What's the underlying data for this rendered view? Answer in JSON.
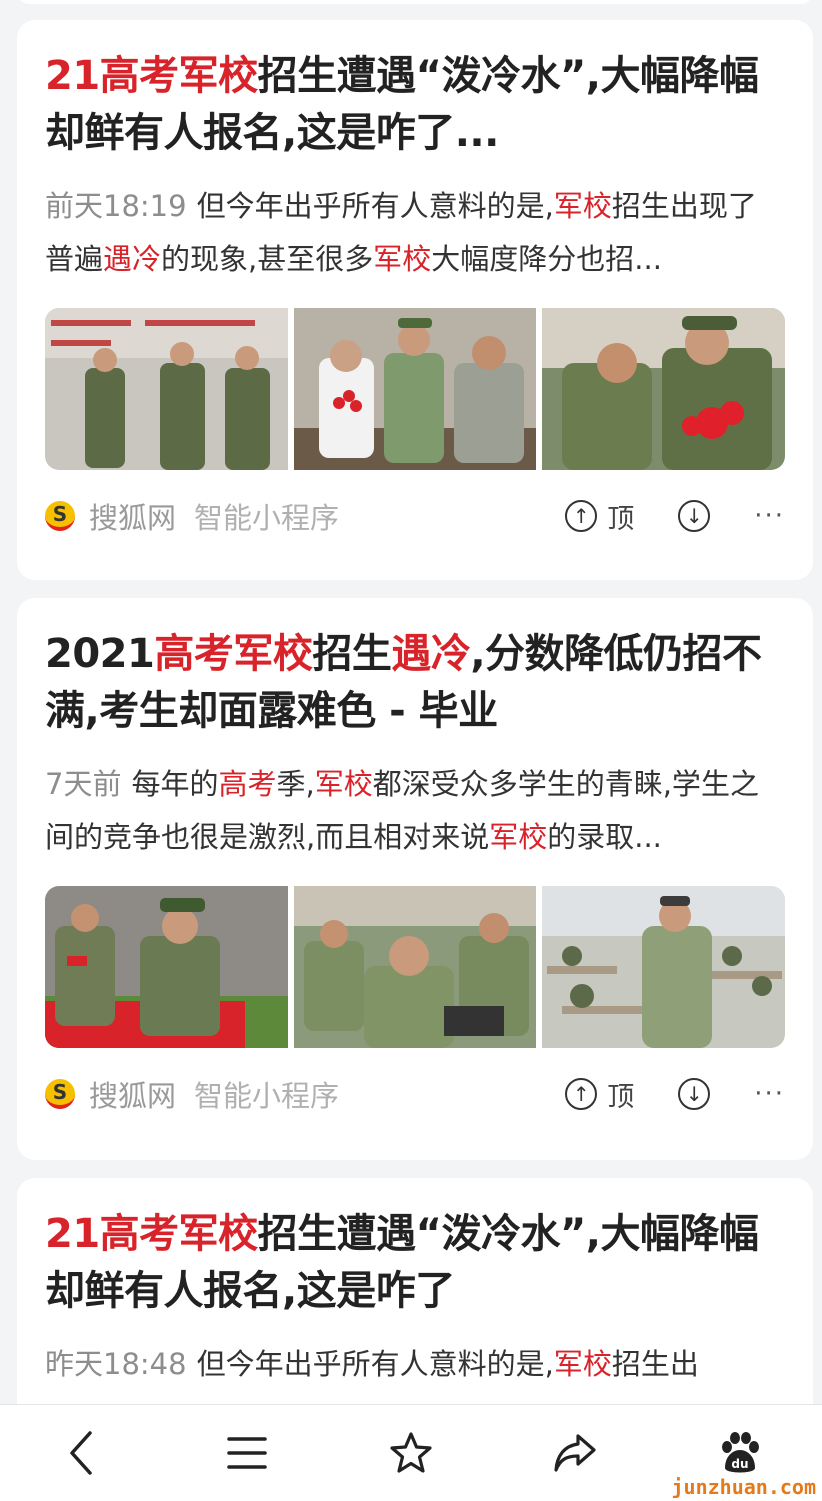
{
  "cards": [
    {
      "title_parts": [
        {
          "text": "21高考军校",
          "hl": true
        },
        {
          "text": "招生遭遇“泼冷水”,大幅降幅却鲜有人报名,这是咋了...",
          "hl": false
        }
      ],
      "time": "前天18:19",
      "snippet_parts": [
        {
          "text": "但今年出乎所有人意料的是,",
          "hl": false
        },
        {
          "text": "军校",
          "hl": true
        },
        {
          "text": "招生出现了普遍",
          "hl": false
        },
        {
          "text": "遇冷",
          "hl": true
        },
        {
          "text": "的现象,甚至很多",
          "hl": false
        },
        {
          "text": "军校",
          "hl": true
        },
        {
          "text": "大幅度降分也招...",
          "hl": false
        }
      ],
      "source": "搜狐网",
      "tag": "智能小程序",
      "up_label": "顶",
      "more": "···"
    },
    {
      "title_parts": [
        {
          "text": "2021",
          "hl": false
        },
        {
          "text": "高考军校",
          "hl": true
        },
        {
          "text": "招生",
          "hl": false
        },
        {
          "text": "遇冷",
          "hl": true
        },
        {
          "text": ",分数降低仍招不满,考生却面露难色 - 毕业",
          "hl": false
        }
      ],
      "time": "7天前",
      "snippet_parts": [
        {
          "text": "每年的",
          "hl": false
        },
        {
          "text": "高考",
          "hl": true
        },
        {
          "text": "季,",
          "hl": false
        },
        {
          "text": "军校",
          "hl": true
        },
        {
          "text": "都深受众多学生的青睐,学生之间的竞争也很是激烈,而且相对来说",
          "hl": false
        },
        {
          "text": "军校",
          "hl": true
        },
        {
          "text": "的录取...",
          "hl": false
        }
      ],
      "source": "搜狐网",
      "tag": "智能小程序",
      "up_label": "顶",
      "more": "···"
    },
    {
      "title_parts": [
        {
          "text": "21高考军校",
          "hl": true
        },
        {
          "text": "招生遭遇“泼冷水”,大幅降幅却鲜有人报名,这是咋了",
          "hl": false
        }
      ],
      "time": "昨天18:48",
      "snippet_parts": [
        {
          "text": "但今年出乎所有人意料的是,",
          "hl": false
        },
        {
          "text": "军校",
          "hl": true
        },
        {
          "text": "招生出",
          "hl": false
        }
      ]
    }
  ],
  "bottom_nav": [
    {
      "name": "back-icon"
    },
    {
      "name": "menu-icon"
    },
    {
      "name": "star-icon"
    },
    {
      "name": "share-icon"
    },
    {
      "name": "baidu-paw-icon"
    }
  ],
  "watermark": "junzhuan.com",
  "colors": {
    "highlight": "#d8232a",
    "muted": "#8d8d8d",
    "card_bg": "#ffffff",
    "page_bg": "#f3f4f6"
  }
}
